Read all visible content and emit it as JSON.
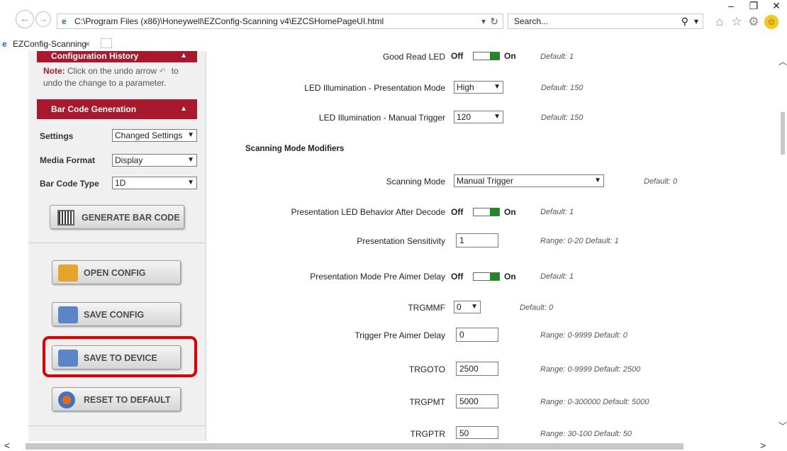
{
  "window": {
    "minimize": "–",
    "restore": "❐",
    "close": "✕"
  },
  "nav": {
    "back": "←",
    "forward": "→",
    "address": "C:\\Program Files (x86)\\Honeywell\\EZConfig-Scanning v4\\EZCSHomePageUI.html",
    "address_dropdown": "▾",
    "refresh": "↻",
    "search_placeholder": "Search...",
    "search_icon": "⚲",
    "search_dropdown": "▾"
  },
  "tab": {
    "title": "EZConfig-Scanning",
    "close": "×"
  },
  "sidebar": {
    "config_history_title": "Configuration History",
    "note_bold": "Note:",
    "note_text_1": "Click on the undo arrow",
    "note_text_2": "to",
    "note_text_3": "undo the change to a parameter.",
    "barcode_gen_title": "Bar Code Generation",
    "collapse_arrow": "▲",
    "settings_label": "Settings",
    "settings_value": "Changed Settings",
    "media_label": "Media Format",
    "media_value": "Display",
    "type_label": "Bar Code Type",
    "type_value": "1D",
    "generate_button": "GENERATE BAR CODE",
    "open_button": "OPEN CONFIG",
    "save_config_button": "SAVE CONFIG",
    "save_device_button": "SAVE TO DEVICE",
    "reset_button": "RESET TO DEFAULT",
    "highlight_color": "#e00000"
  },
  "toggle_labels": {
    "off": "Off",
    "on": "On"
  },
  "form": {
    "good_read_led": {
      "label": "Good Read LED",
      "default": "Default: 1"
    },
    "led_presentation": {
      "label": "LED Illumination - Presentation Mode",
      "value": "High",
      "default": "Default: 150"
    },
    "led_manual": {
      "label": "LED Illumination - Manual Trigger",
      "value": "120",
      "default": "Default: 150"
    },
    "section_title": "Scanning Mode Modifiers",
    "scanning_mode": {
      "label": "Scanning Mode",
      "value": "Manual Trigger",
      "default": "Default: 0"
    },
    "pres_led_behavior": {
      "label": "Presentation LED Behavior After Decode",
      "default": "Default: 1"
    },
    "pres_sensitivity": {
      "label": "Presentation Sensitivity",
      "value": "1",
      "hint": "Range: 0-20  Default: 1"
    },
    "pres_aimer_delay": {
      "label": "Presentation Mode Pre Aimer Delay",
      "default": "Default: 1"
    },
    "trgmmf": {
      "label": "TRGMMF",
      "value": "0",
      "default": "Default: 0"
    },
    "trigger_aimer_delay": {
      "label": "Trigger Pre Aimer Delay",
      "value": "0",
      "hint": "Range: 0-9999  Default: 0"
    },
    "trgoto": {
      "label": "TRGOTO",
      "value": "2500",
      "hint": "Range: 0-9999  Default: 2500"
    },
    "trgpmt": {
      "label": "TRGPMT",
      "value": "5000",
      "hint": "Range: 0-300000  Default: 5000"
    },
    "trgptr": {
      "label": "TRGPTR",
      "value": "50",
      "hint": "Range: 30-100  Default: 50"
    }
  },
  "scrollbars": {
    "up": "︿",
    "down": "﹀",
    "left": "<",
    "right": ">"
  }
}
